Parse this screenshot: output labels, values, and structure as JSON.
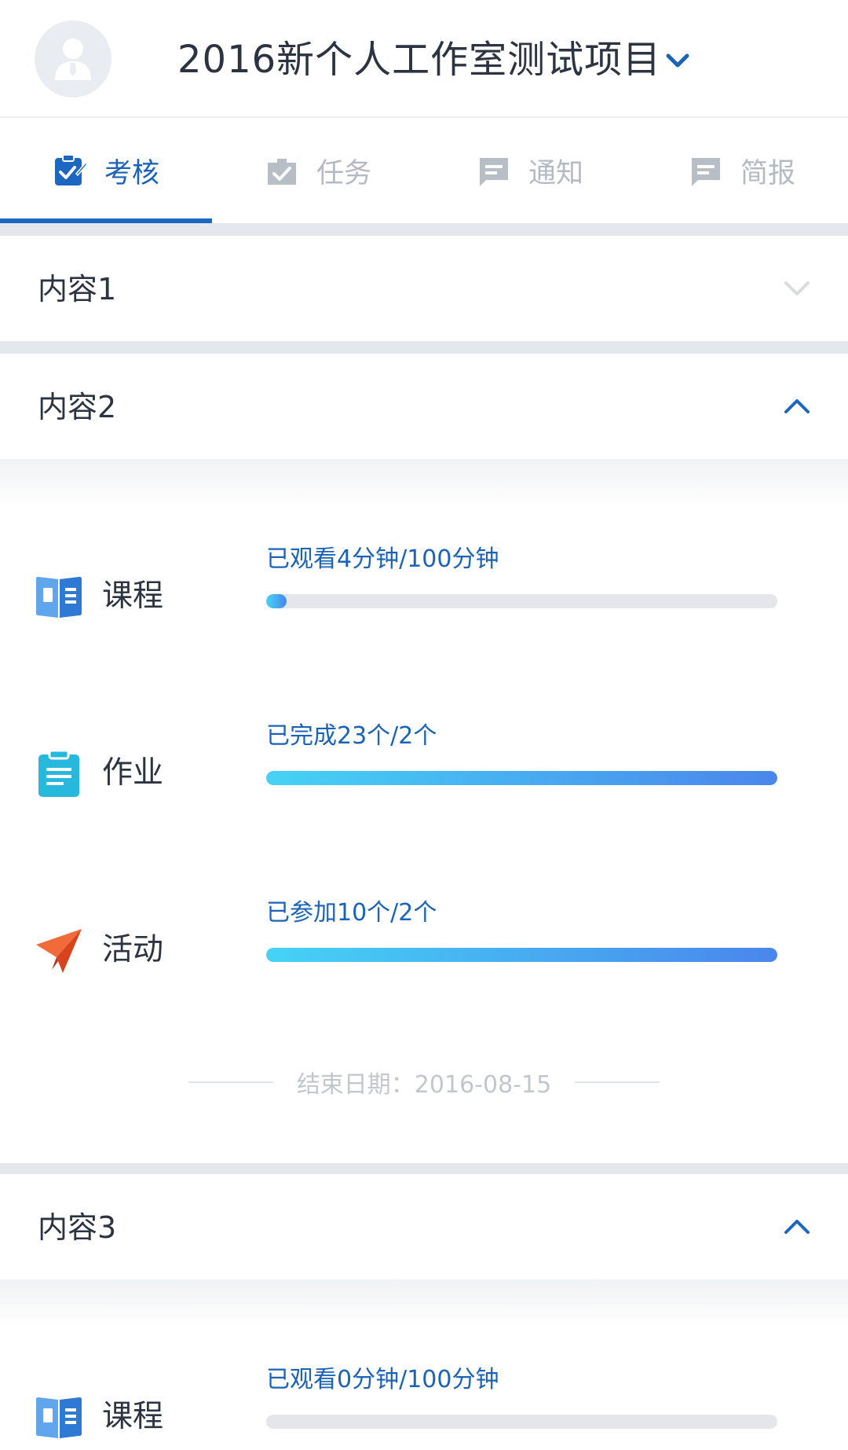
{
  "header": {
    "title": "2016新个人工作室测试项目",
    "avatar_icon": "user-avatar-icon",
    "dropdown_icon": "chevron-down-icon"
  },
  "tabs": [
    {
      "label": "考核",
      "icon": "clipboard-check-icon",
      "active": true
    },
    {
      "label": "任务",
      "icon": "task-check-icon",
      "active": false
    },
    {
      "label": "通知",
      "icon": "message-icon",
      "active": false
    },
    {
      "label": "简报",
      "icon": "report-icon",
      "active": false
    }
  ],
  "sections": [
    {
      "title": "内容1",
      "expanded": false
    },
    {
      "title": "内容2",
      "expanded": true,
      "items": [
        {
          "label": "课程",
          "icon": "book-icon",
          "progress_text": "已观看4分钟/100分钟",
          "progress": 0.04
        },
        {
          "label": "作业",
          "icon": "clipboard-icon",
          "progress_text": "已完成23个/2个",
          "progress": 1.0
        },
        {
          "label": "活动",
          "icon": "paper-plane-icon",
          "progress_text": "已参加10个/2个",
          "progress": 1.0
        }
      ],
      "end_date": "结束日期：2016-08-15"
    },
    {
      "title": "内容3",
      "expanded": true,
      "items": [
        {
          "label": "课程",
          "icon": "book-icon",
          "progress_text": "已观看0分钟/100分钟",
          "progress": 0.0
        }
      ]
    }
  ],
  "colors": {
    "accent": "#1a63b8",
    "progress_start": "#45d3f5",
    "progress_end": "#4a86ec",
    "track": "#e4e6e9",
    "separator": "#e4e7eb"
  }
}
